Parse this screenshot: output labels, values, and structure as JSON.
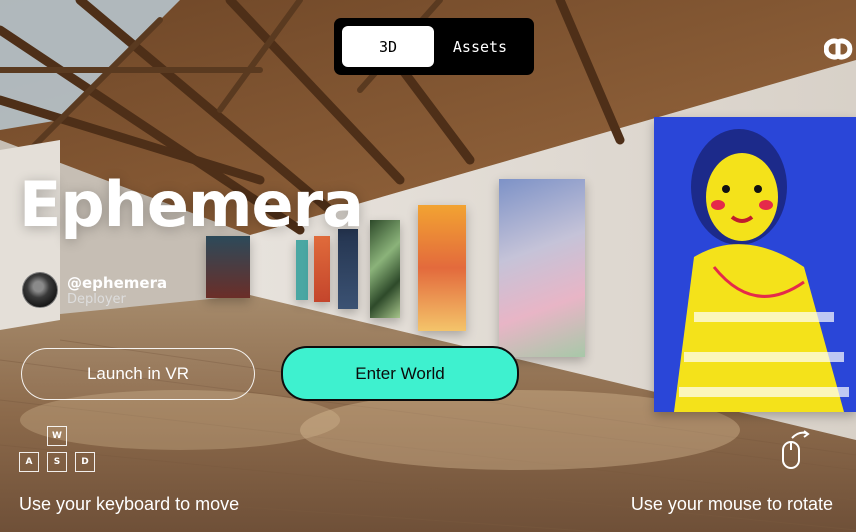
{
  "view_toggle": {
    "options": [
      "3D",
      "Assets"
    ],
    "active": "3D"
  },
  "world": {
    "title": "Ephemera",
    "creator_handle": "@ephemera",
    "creator_role": "Deployer"
  },
  "actions": {
    "launch_vr": "Launch in VR",
    "enter_world": "Enter World"
  },
  "controls": {
    "keys": [
      "W",
      "A",
      "S",
      "D"
    ],
    "keyboard_hint": "Use your keyboard to move",
    "mouse_hint": "Use your mouse to rotate"
  },
  "colors": {
    "accent": "#3ef1cf",
    "toggle_bg": "#000000"
  },
  "icons": [
    "logo-icon",
    "wasd-keys-icon",
    "mouse-rotate-icon"
  ]
}
